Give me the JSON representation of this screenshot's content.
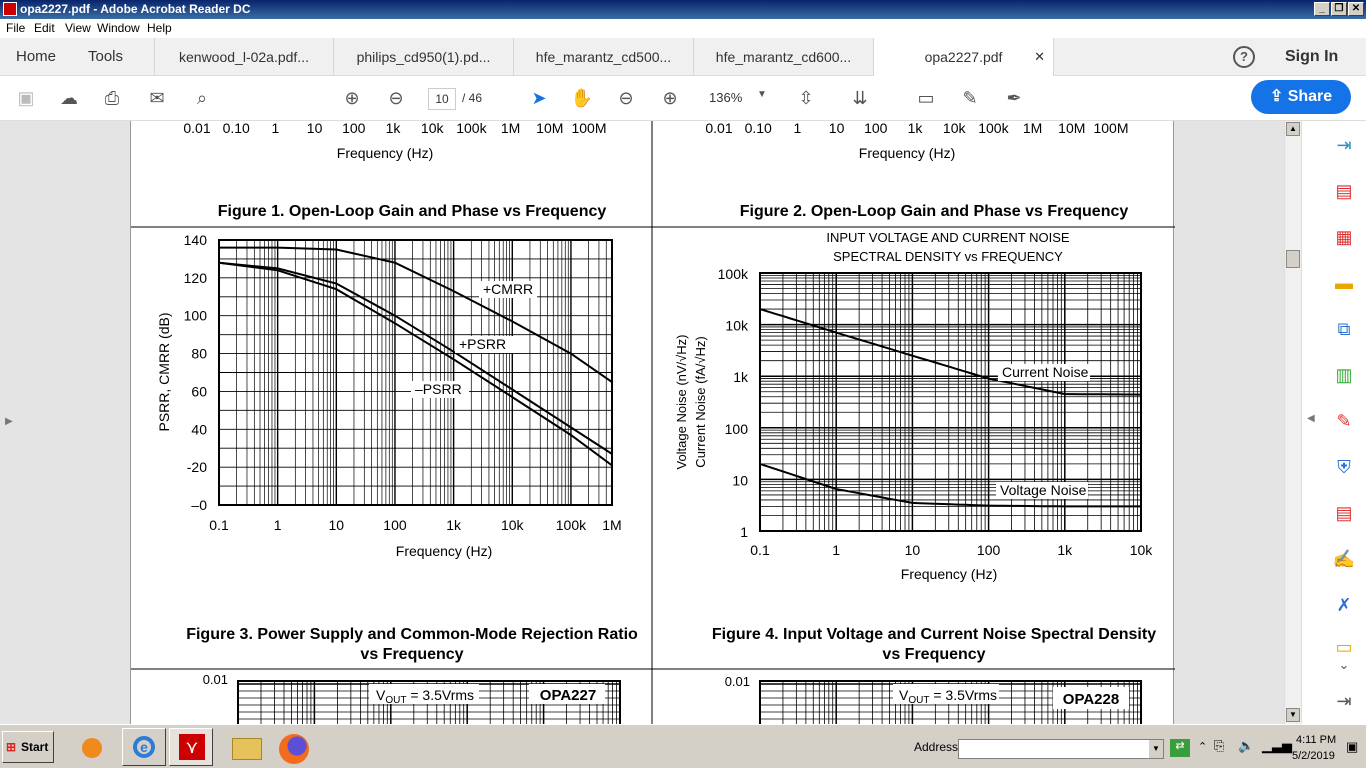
{
  "window": {
    "title": "opa2227.pdf - Adobe Acrobat Reader DC"
  },
  "menu": [
    "File",
    "Edit",
    "View",
    "Window",
    "Help"
  ],
  "tabs": {
    "home": "Home",
    "tools": "Tools",
    "signin": "Sign In",
    "docs": [
      "kenwood_l-02a.pdf...",
      "philips_cd950(1).pd...",
      "hfe_marantz_cd500...",
      "hfe_marantz_cd600...",
      "opa2227.pdf"
    ]
  },
  "toolbar": {
    "page": "10",
    "total": "/ 46",
    "zoom": "136%",
    "share": "Share"
  },
  "doc": {
    "top_ticks": [
      "0.01",
      "0.10",
      "1",
      "10",
      "100",
      "1k",
      "10k",
      "100k",
      "1M",
      "10M",
      "100M"
    ],
    "freq_label": "Frequency (Hz)",
    "fig1": "Figure 1. Open-Loop Gain and Phase vs Frequency",
    "fig2": "Figure 2. Open-Loop Gain and Phase vs Frequency",
    "fig3_line1": "Figure 3. Power Supply and Common-Mode Rejection Ratio",
    "fig3_line2": "vs Frequency",
    "fig4_line1": "Figure 4. Input Voltage and Current Noise Spectral Density",
    "fig4_line2": "vs Frequency",
    "vout": "V",
    "vout_sub": "OUT",
    "vout_val": " = 3.5Vrms",
    "opa227": "OPA227",
    "opa228": "OPA228",
    "ytop": "0.01"
  },
  "chart_data": [
    {
      "type": "line",
      "title": "",
      "xlabel": "Frequency (Hz)",
      "ylabel": "PSRR, CMRR (dB)",
      "x_ticks": [
        "0.1",
        "1",
        "10",
        "100",
        "1k",
        "10k",
        "100k",
        "1M"
      ],
      "y_ticks": [
        "140",
        "120",
        "100",
        "80",
        "60",
        "40",
        "-20",
        "–0"
      ],
      "series": [
        {
          "name": "+CMRR",
          "x": [
            0.1,
            1,
            10,
            100,
            1000,
            10000,
            100000,
            500000
          ],
          "y": [
            136,
            136,
            135,
            128,
            113,
            97,
            80,
            65
          ]
        },
        {
          "name": "+PSRR",
          "x": [
            0.1,
            1,
            10,
            100,
            1000,
            10000,
            100000,
            500000
          ],
          "y": [
            128,
            125,
            117,
            100,
            81,
            61,
            41,
            27
          ]
        },
        {
          "name": "–PSRR",
          "x": [
            0.1,
            1,
            10,
            100,
            1000,
            10000,
            100000,
            500000
          ],
          "y": [
            128,
            124,
            114,
            96,
            77,
            57,
            37,
            21
          ]
        }
      ]
    },
    {
      "type": "line",
      "title": "INPUT VOLTAGE AND CURRENT NOISE",
      "subtitle": "SPECTRAL DENSITY vs FREQUENCY",
      "xlabel": "Frequency (Hz)",
      "ylabel1": "Voltage Noise (nV/√Hz)",
      "ylabel2": "Current Noise (fA/√Hz)",
      "x_ticks": [
        "0.1",
        "1",
        "10",
        "100",
        "1k",
        "10k"
      ],
      "y_ticks": [
        "100k",
        "10k",
        "1k",
        "100",
        "10",
        "1"
      ],
      "series": [
        {
          "name": "Current Noise",
          "x": [
            0.1,
            1,
            10,
            100,
            1000,
            10000
          ],
          "y": [
            20000,
            7000,
            2500,
            900,
            450,
            440
          ]
        },
        {
          "name": "Voltage Noise",
          "x": [
            0.1,
            1,
            10,
            100,
            1000,
            10000
          ],
          "y": [
            20,
            6.5,
            3.5,
            3.1,
            3.0,
            3.0
          ]
        }
      ]
    }
  ],
  "taskbar": {
    "start": "Start",
    "address": "Address",
    "time": "4:11 PM",
    "date": "5/2/2019"
  }
}
